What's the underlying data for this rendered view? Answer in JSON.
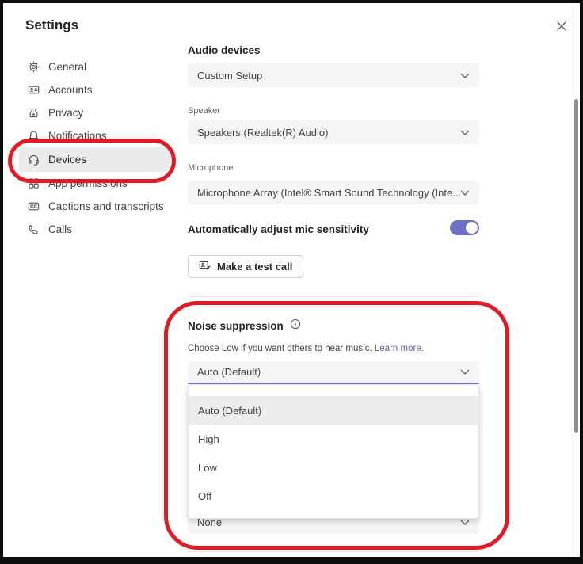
{
  "window": {
    "title": "Settings"
  },
  "sidebar": {
    "items": [
      {
        "label": "General",
        "icon": "gear-icon",
        "selected": false
      },
      {
        "label": "Accounts",
        "icon": "id-card-icon",
        "selected": false
      },
      {
        "label": "Privacy",
        "icon": "lock-icon",
        "selected": false
      },
      {
        "label": "Notifications",
        "icon": "bell-icon",
        "selected": false
      },
      {
        "label": "Devices",
        "icon": "headset-icon",
        "selected": true
      },
      {
        "label": "App permissions",
        "icon": "apps-icon",
        "selected": false
      },
      {
        "label": "Captions and transcripts",
        "icon": "captions-icon",
        "selected": false
      },
      {
        "label": "Calls",
        "icon": "phone-icon",
        "selected": false
      }
    ]
  },
  "main": {
    "audio_devices": {
      "heading": "Audio devices",
      "selected_value": "Custom Setup"
    },
    "speaker": {
      "label": "Speaker",
      "selected_value": "Speakers (Realtek(R) Audio)"
    },
    "microphone": {
      "label": "Microphone",
      "selected_value": "Microphone Array (Intel® Smart Sound Technology (Inte..."
    },
    "mic_sensitivity": {
      "label": "Automatically adjust mic sensitivity",
      "enabled": true
    },
    "test_call": {
      "label": "Make a test call"
    },
    "noise_suppression": {
      "heading": "Noise suppression",
      "description": "Choose Low if you want others to hear music.",
      "link_label": "Learn more.",
      "selected_value": "Auto (Default)",
      "options": [
        "Auto (Default)",
        "High",
        "Low",
        "Off"
      ]
    },
    "secondary_ringer": {
      "selected_value": "None"
    }
  },
  "colors": {
    "accent_purple": "#6b70c0",
    "annotation_red": "#e11b23",
    "selected_bg": "#ebebeb",
    "field_bg": "#f5f5f5"
  }
}
